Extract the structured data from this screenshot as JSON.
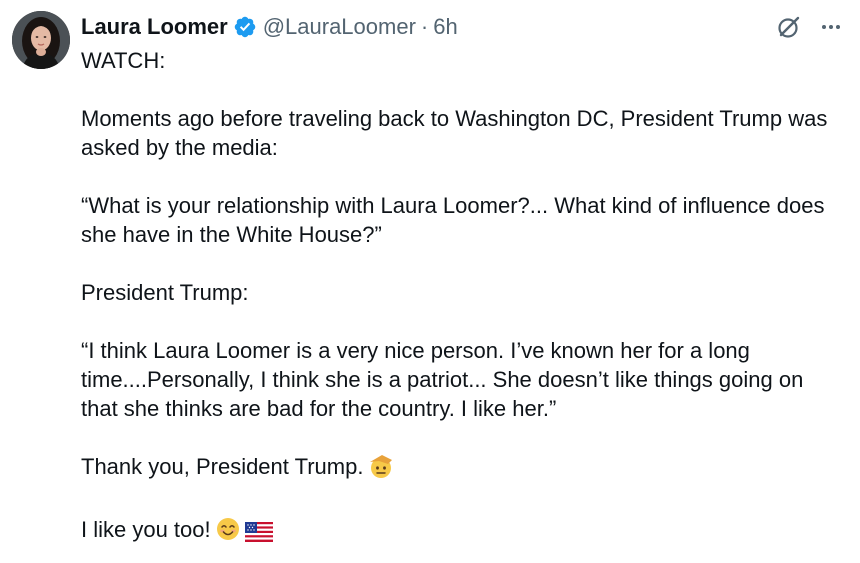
{
  "author": {
    "name": "Laura Loomer",
    "handle": "@LauraLoomer",
    "separator": "·",
    "time": "6h",
    "verified_color": "#1d9bf0"
  },
  "icons": {
    "avatar": "profile-photo",
    "verified": "verified-badge-icon",
    "grok": "grok-icon",
    "more": "more-icon",
    "emoji_salute": "saluting-face-emoji",
    "emoji_smile": "smiling-face-emoji",
    "emoji_flag": "us-flag-emoji"
  },
  "tweet": {
    "paragraphs": [
      "WATCH:",
      "Moments ago before traveling back to Washington DC, President Trump was asked by the media:",
      "“What is your relationship with Laura Loomer?... What kind of influence does she have in the White House?”",
      "President Trump:",
      "“I think Laura Loomer is a very nice person. I’ve known her for a long time....Personally, I think she is a patriot... She doesn’t like things going on that she thinks are bad for the country. I like her.”",
      "Thank you, President Trump.",
      "I like you too!"
    ]
  },
  "colors": {
    "text": "#0f1419",
    "secondary": "#536471",
    "accent": "#1d9bf0"
  }
}
